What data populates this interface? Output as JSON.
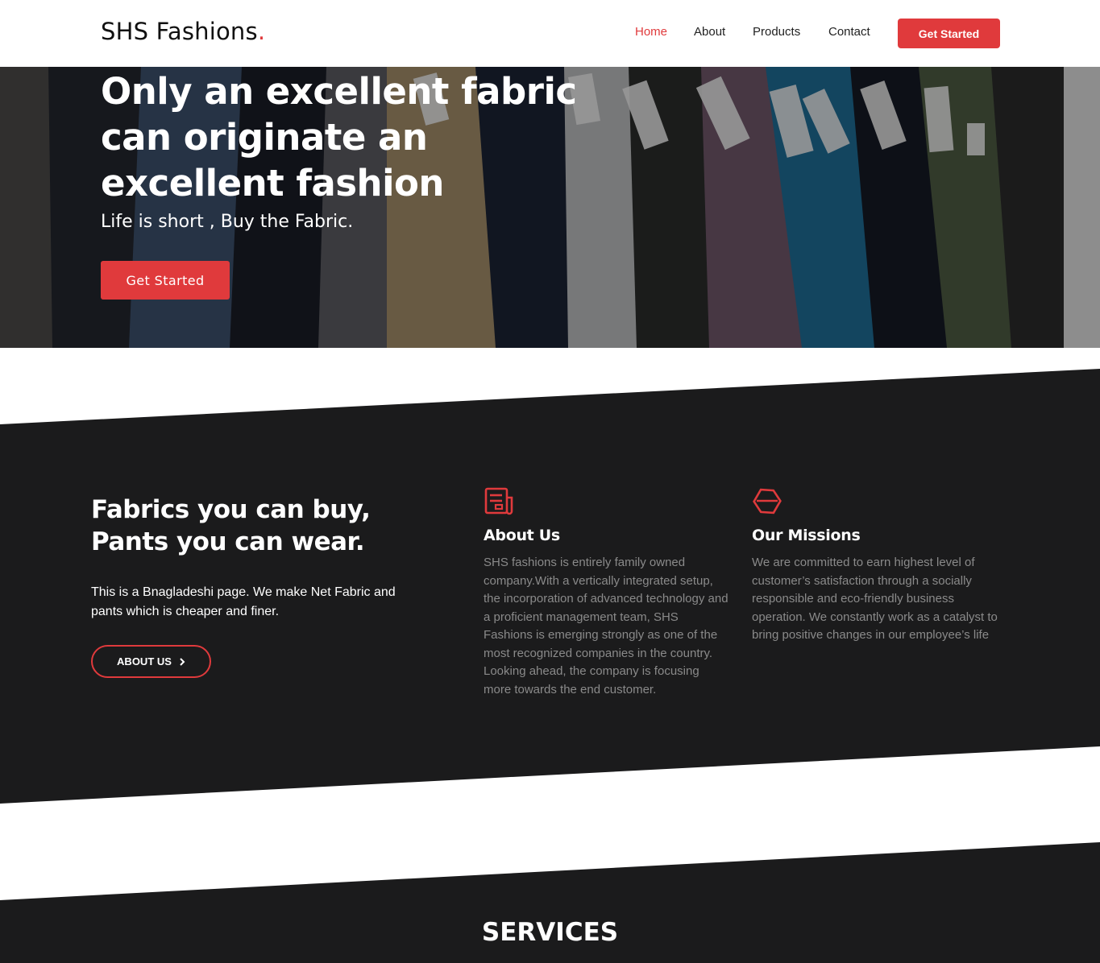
{
  "header": {
    "logo_text": "SHS Fashions",
    "logo_dot": ".",
    "nav": [
      "Home",
      "About",
      "Products",
      "Contact"
    ],
    "cta": "Get Started"
  },
  "hero": {
    "title": "Only an excellent fabric can originate an excellent fashion",
    "subtitle": "Life is short , Buy the Fabric.",
    "cta": "Get Started"
  },
  "about": {
    "title_line1": "Fabrics you can buy,",
    "title_line2": "Pants you can wear.",
    "text": "This is a Bnagladeshi page. We make Net Fabric and pants which is cheaper and finer.",
    "button": "ABOUT US"
  },
  "features": [
    {
      "icon": "document-icon",
      "title": "About Us",
      "text": "SHS fashions is entirely family owned company.With a vertically integrated setup, the incorporation of advanced technology and a proficient management team, SHS Fashions is emerging strongly as one of the most recognized companies in the country. Looking ahead, the company is focusing more towards the end customer."
    },
    {
      "icon": "hexagon-icon",
      "title": "Our Missions",
      "text": "We are committed to earn highest level of customer’s satisfaction through a socially responsible and eco-friendly business operation. We constantly work as a catalyst to bring positive changes in our employee’s life"
    }
  ],
  "services": {
    "title": "SERVICES"
  },
  "colors": {
    "accent": "#e03a3c",
    "dark": "#1b1b1c",
    "muted_text": "#8a8a8a"
  }
}
